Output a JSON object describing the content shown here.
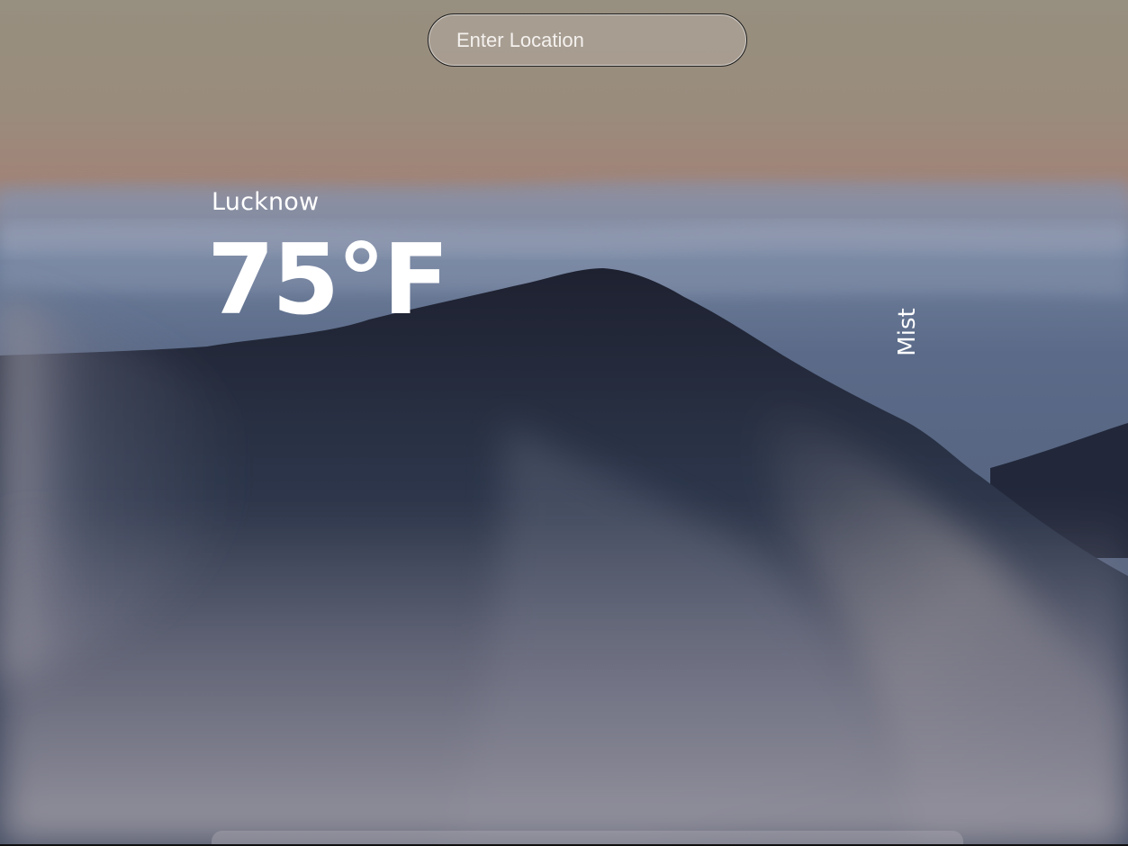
{
  "search": {
    "placeholder": "Enter Location",
    "value": ""
  },
  "weather": {
    "city": "Lucknow",
    "temperature": "75°F",
    "condition": "Mist"
  },
  "background": {
    "scene": "misty-mountain-icon"
  }
}
